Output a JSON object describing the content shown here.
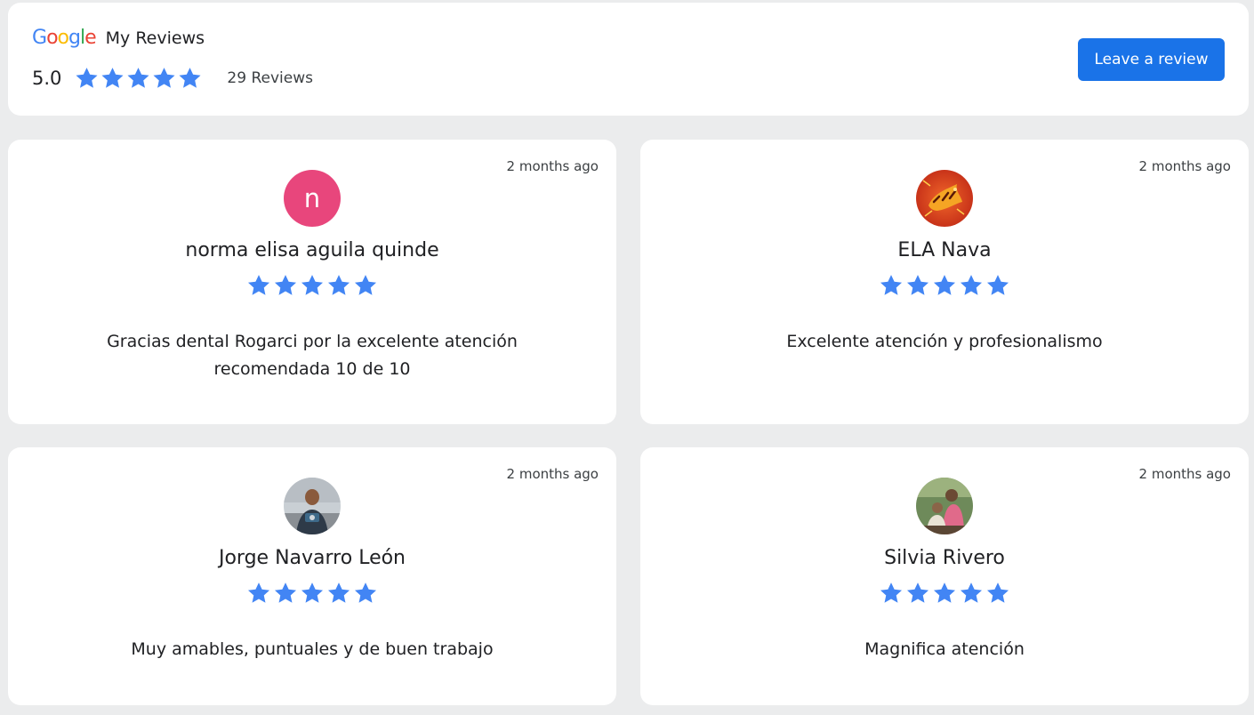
{
  "header": {
    "brand": "Google",
    "title": "My Reviews",
    "rating": "5.0",
    "stars": 5,
    "review_count": "29 Reviews",
    "cta_label": "Leave a review"
  },
  "colors": {
    "accent": "#1a73e8",
    "star": "#4285f4",
    "avatar_letter_bg": "#e8467c"
  },
  "reviews": [
    {
      "time": "2 months ago",
      "avatar_letter": "n",
      "name": "norma elisa aguila quinde",
      "stars": 5,
      "text": "Gracias dental Rogarci por la excelente atención recomendada 10 de 10"
    },
    {
      "time": "2 months ago",
      "avatar_letter": "",
      "name": "ELA Nava",
      "stars": 5,
      "text": "Excelente atención y profesionalismo"
    },
    {
      "time": "2 months ago",
      "avatar_letter": "",
      "name": "Jorge Navarro León",
      "stars": 5,
      "text": "Muy amables, puntuales y de buen trabajo"
    },
    {
      "time": "2 months ago",
      "avatar_letter": "",
      "name": "Silvia Rivero",
      "stars": 5,
      "text": "Magnifica atención"
    }
  ]
}
